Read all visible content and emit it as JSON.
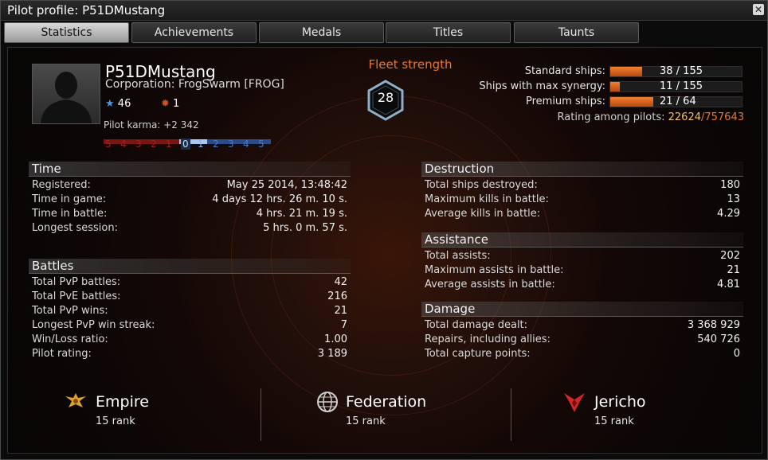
{
  "window": {
    "title": "Pilot profile: P51DMustang",
    "close_icon": "close-icon"
  },
  "tabs": [
    {
      "label": "Statistics",
      "active": true
    },
    {
      "label": "Achievements",
      "active": false
    },
    {
      "label": "Medals",
      "active": false
    },
    {
      "label": "Titles",
      "active": false
    },
    {
      "label": "Taunts",
      "active": false
    }
  ],
  "pilot": {
    "name": "P51DMustang",
    "corporation": "Corporation: FrogSwarm [FROG]",
    "stars": "46",
    "loyalty": "1",
    "karma_label": "Pilot karma: +2 342",
    "karma_scale": [
      "5",
      "4",
      "3",
      "2",
      "1",
      "0",
      "1",
      "2",
      "3",
      "4",
      "5"
    ]
  },
  "fleet": {
    "label": "Fleet strength",
    "value": "28"
  },
  "ships": {
    "standard_label": "Standard ships:",
    "standard_value": "38 / 155",
    "standard_fraction": 0.245,
    "synergy_label": "Ships with max synergy:",
    "synergy_value": "11 / 155",
    "synergy_fraction": 0.071,
    "premium_label": "Premium ships:",
    "premium_value": "21 / 64",
    "premium_fraction": 0.328,
    "rating_label": "Rating among pilots:",
    "rating_value": "22624",
    "rating_total": "/757643"
  },
  "time": {
    "header": "Time",
    "rows": [
      {
        "k": "Registered:",
        "v": "May 25 2014, 13:48:42"
      },
      {
        "k": "Time in game:",
        "v": "4 days 12 hrs. 26 m. 10 s."
      },
      {
        "k": "Time in battle:",
        "v": "4 hrs. 21 m. 19 s."
      },
      {
        "k": "Longest session:",
        "v": "5 hrs. 0 m. 57 s."
      }
    ]
  },
  "battles": {
    "header": "Battles",
    "rows": [
      {
        "k": "Total PvP battles:",
        "v": "42"
      },
      {
        "k": "Total PvE battles:",
        "v": "216"
      },
      {
        "k": "Total PvP wins:",
        "v": "21"
      },
      {
        "k": "Longest PvP win streak:",
        "v": "7"
      },
      {
        "k": "Win/Loss ratio:",
        "v": "1.00"
      },
      {
        "k": "Pilot rating:",
        "v": "3 189"
      }
    ]
  },
  "destruction": {
    "header": "Destruction",
    "rows": [
      {
        "k": "Total ships destroyed:",
        "v": "180"
      },
      {
        "k": "Maximum kills in battle:",
        "v": "13"
      },
      {
        "k": "Average kills in battle:",
        "v": "4.29"
      }
    ]
  },
  "assistance": {
    "header": "Assistance",
    "rows": [
      {
        "k": "Total assists:",
        "v": "202"
      },
      {
        "k": "Maximum assists in battle:",
        "v": "21"
      },
      {
        "k": "Average assists in battle:",
        "v": "4.81"
      }
    ]
  },
  "damage": {
    "header": "Damage",
    "rows": [
      {
        "k": "Total damage dealt:",
        "v": "3 368 929"
      },
      {
        "k": "Repairs, including allies:",
        "v": "540 726"
      },
      {
        "k": "Total capture points:",
        "v": "0"
      }
    ]
  },
  "factions": [
    {
      "name": "Empire",
      "rank": "15 rank",
      "icon": "empire-eagle-icon"
    },
    {
      "name": "Federation",
      "rank": "15 rank",
      "icon": "federation-globe-icon"
    },
    {
      "name": "Jericho",
      "rank": "15 rank",
      "icon": "jericho-emblem-icon"
    }
  ],
  "colors": {
    "accent": "#e8782a",
    "bar_fill": "#e8782a",
    "karma_negative": "#a02020",
    "karma_positive": "#6fa0e0"
  }
}
